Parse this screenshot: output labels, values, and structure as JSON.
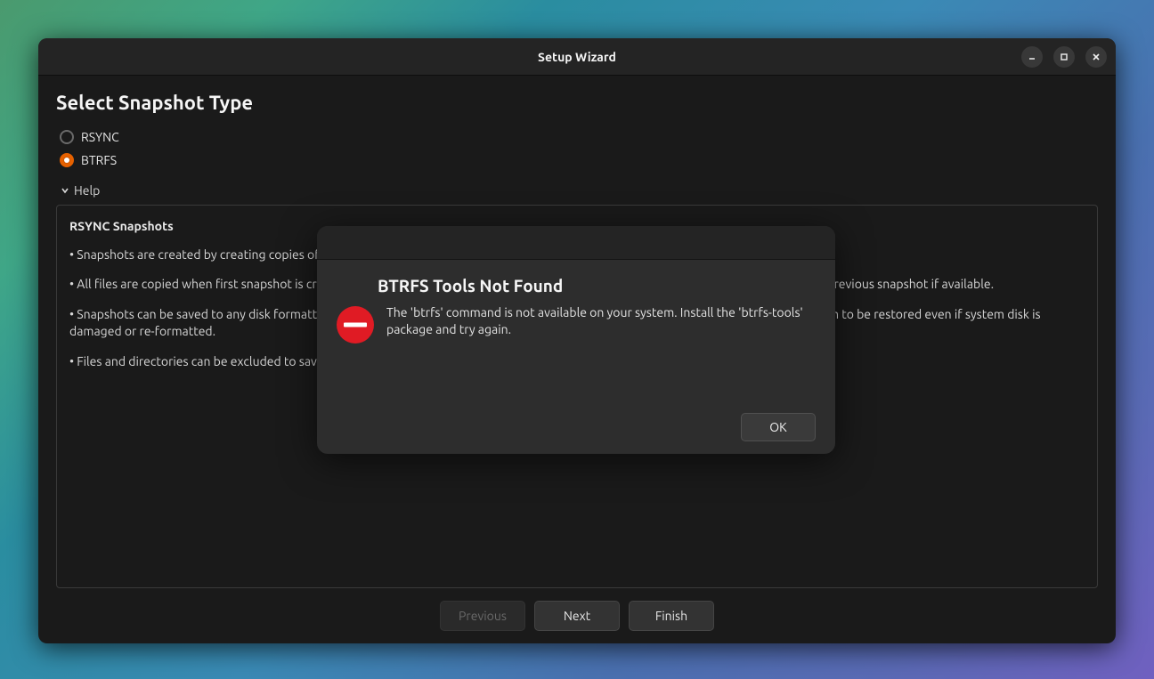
{
  "window": {
    "title": "Setup Wizard"
  },
  "page": {
    "title": "Select Snapshot Type"
  },
  "options": {
    "rsync": {
      "label": "RSYNC",
      "selected": false
    },
    "btrfs": {
      "label": "BTRFS",
      "selected": true
    }
  },
  "help": {
    "toggle_label": "Help",
    "heading": "RSYNC Snapshots",
    "bullets": [
      "Snapshots are created by creating copies of system files using rsync, and hard-linking unchanged files from previous snapshot.",
      "All files are copied when first snapshot is created. Subsequent snapshots are incremental. Unchanged files will be hard-linked from the previous snapshot if available.",
      "Snapshots can be saved to any disk formatted with a Linux file system. Saving snapshots to non-system or external disk allows the system to be restored even if system disk is damaged or re-formatted.",
      "Files and directories can be excluded to save disk space."
    ]
  },
  "wizard": {
    "previous_label": "Previous",
    "next_label": "Next",
    "finish_label": "Finish"
  },
  "modal": {
    "title": "BTRFS Tools Not Found",
    "message": "The 'btrfs' command is not available on your system. Install the 'btrfs-tools' package and try again.",
    "ok_label": "OK"
  }
}
